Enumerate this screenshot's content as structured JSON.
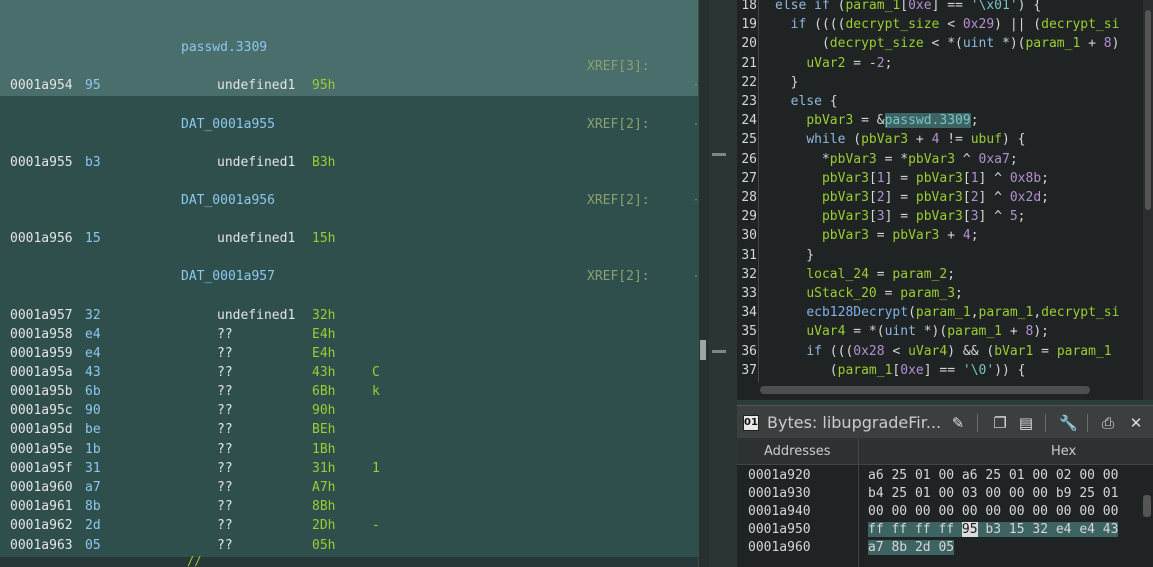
{
  "listing": {
    "label_passwd": "passwd.3309",
    "xref_passwd": "XREF[3]:",
    "rows": [
      {
        "addr": "0001a954",
        "byte": "95",
        "type": "undefined1",
        "val": "95h",
        "char": ""
      },
      {
        "label": "DAT_0001a955",
        "xref": "XREF[2]:"
      },
      {
        "addr": "0001a955",
        "byte": "b3",
        "type": "undefined1",
        "val": "B3h",
        "char": ""
      },
      {
        "label": "DAT_0001a956",
        "xref": "XREF[2]:"
      },
      {
        "addr": "0001a956",
        "byte": "15",
        "type": "undefined1",
        "val": "15h",
        "char": ""
      },
      {
        "label": "DAT_0001a957",
        "xref": "XREF[2]:"
      },
      {
        "addr": "0001a957",
        "byte": "32",
        "type": "undefined1",
        "val": "32h",
        "char": ""
      },
      {
        "addr": "0001a958",
        "byte": "e4",
        "type": "??",
        "val": "E4h",
        "char": ""
      },
      {
        "addr": "0001a959",
        "byte": "e4",
        "type": "??",
        "val": "E4h",
        "char": ""
      },
      {
        "addr": "0001a95a",
        "byte": "43",
        "type": "??",
        "val": "43h",
        "char": "C"
      },
      {
        "addr": "0001a95b",
        "byte": "6b",
        "type": "??",
        "val": "6Bh",
        "char": "k"
      },
      {
        "addr": "0001a95c",
        "byte": "90",
        "type": "??",
        "val": "90h",
        "char": ""
      },
      {
        "addr": "0001a95d",
        "byte": "be",
        "type": "??",
        "val": "BEh",
        "char": ""
      },
      {
        "addr": "0001a95e",
        "byte": "1b",
        "type": "??",
        "val": "1Bh",
        "char": ""
      },
      {
        "addr": "0001a95f",
        "byte": "31",
        "type": "??",
        "val": "31h",
        "char": "1"
      },
      {
        "addr": "0001a960",
        "byte": "a7",
        "type": "??",
        "val": "A7h",
        "char": ""
      },
      {
        "addr": "0001a961",
        "byte": "8b",
        "type": "??",
        "val": "8Bh",
        "char": ""
      },
      {
        "addr": "0001a962",
        "byte": "2d",
        "type": "??",
        "val": "2Dh",
        "char": "-"
      },
      {
        "addr": "0001a963",
        "byte": "05",
        "type": "??",
        "val": "05h",
        "char": ""
      }
    ],
    "bottom_slash": "//"
  },
  "decompiler": {
    "lines": [
      {
        "n": "18",
        "text": "else if (param_1[0xe] == '\\x01') {"
      },
      {
        "n": "19",
        "text": "  if ((((decrypt_size < 0x29) || (decrypt_si"
      },
      {
        "n": "20",
        "text": "      (decrypt_size < *(uint *)(param_1 + 8)"
      },
      {
        "n": "21",
        "text": "    uVar2 = -2;"
      },
      {
        "n": "22",
        "text": "  }"
      },
      {
        "n": "23",
        "text": "  else {"
      },
      {
        "n": "24",
        "text": "    pbVar3 = &passwd.3309;"
      },
      {
        "n": "25",
        "text": "    while (pbVar3 + 4 != ubuf) {"
      },
      {
        "n": "26",
        "text": "      *pbVar3 = *pbVar3 ^ 0xa7;"
      },
      {
        "n": "27",
        "text": "      pbVar3[1] = pbVar3[1] ^ 0x8b;"
      },
      {
        "n": "28",
        "text": "      pbVar3[2] = pbVar3[2] ^ 0x2d;"
      },
      {
        "n": "29",
        "text": "      pbVar3[3] = pbVar3[3] ^ 5;"
      },
      {
        "n": "30",
        "text": "      pbVar3 = pbVar3 + 4;"
      },
      {
        "n": "31",
        "text": "    }"
      },
      {
        "n": "32",
        "text": "    local_24 = param_2;"
      },
      {
        "n": "33",
        "text": "    uStack_20 = param_3;"
      },
      {
        "n": "34",
        "text": "    ecb128Decrypt(param_1,param_1,decrypt_si"
      },
      {
        "n": "35",
        "text": "    uVar4 = *(uint *)(param_1 + 8);"
      },
      {
        "n": "36",
        "text": "    if (((0x28 < uVar4) && (bVar1 = param_1"
      },
      {
        "n": "37",
        "text": "       (param_1[0xe] == '\\0')) {"
      }
    ]
  },
  "bytes": {
    "title": "Bytes: libupgradeFir...",
    "col_addresses": "Addresses",
    "col_hex": "Hex",
    "rows": [
      {
        "addr": "0001a920",
        "hex": "a6 25 01 00 a6 25 01 00 02 00 00"
      },
      {
        "addr": "0001a930",
        "hex": "b4 25 01 00 03 00 00 00 b9 25 01"
      },
      {
        "addr": "0001a940",
        "hex": "00 00 00 00 00 00 00 00 00 00 00"
      },
      {
        "addr": "0001a950",
        "hex_a": "ff ff ff ff ",
        "hex_cur": "95",
        "hex_b": " b3 15 32 e4 e4 43"
      },
      {
        "addr": "0001a960",
        "hex_sel": "a7 8b 2d 05"
      }
    ]
  },
  "colors": {
    "listing_bg": "#2f4f4d",
    "listing_highlight": "#4a6e6b",
    "decompiler_bg": "#1f2323",
    "label_blue": "#8cc8ee",
    "value_green": "#9acd32"
  }
}
